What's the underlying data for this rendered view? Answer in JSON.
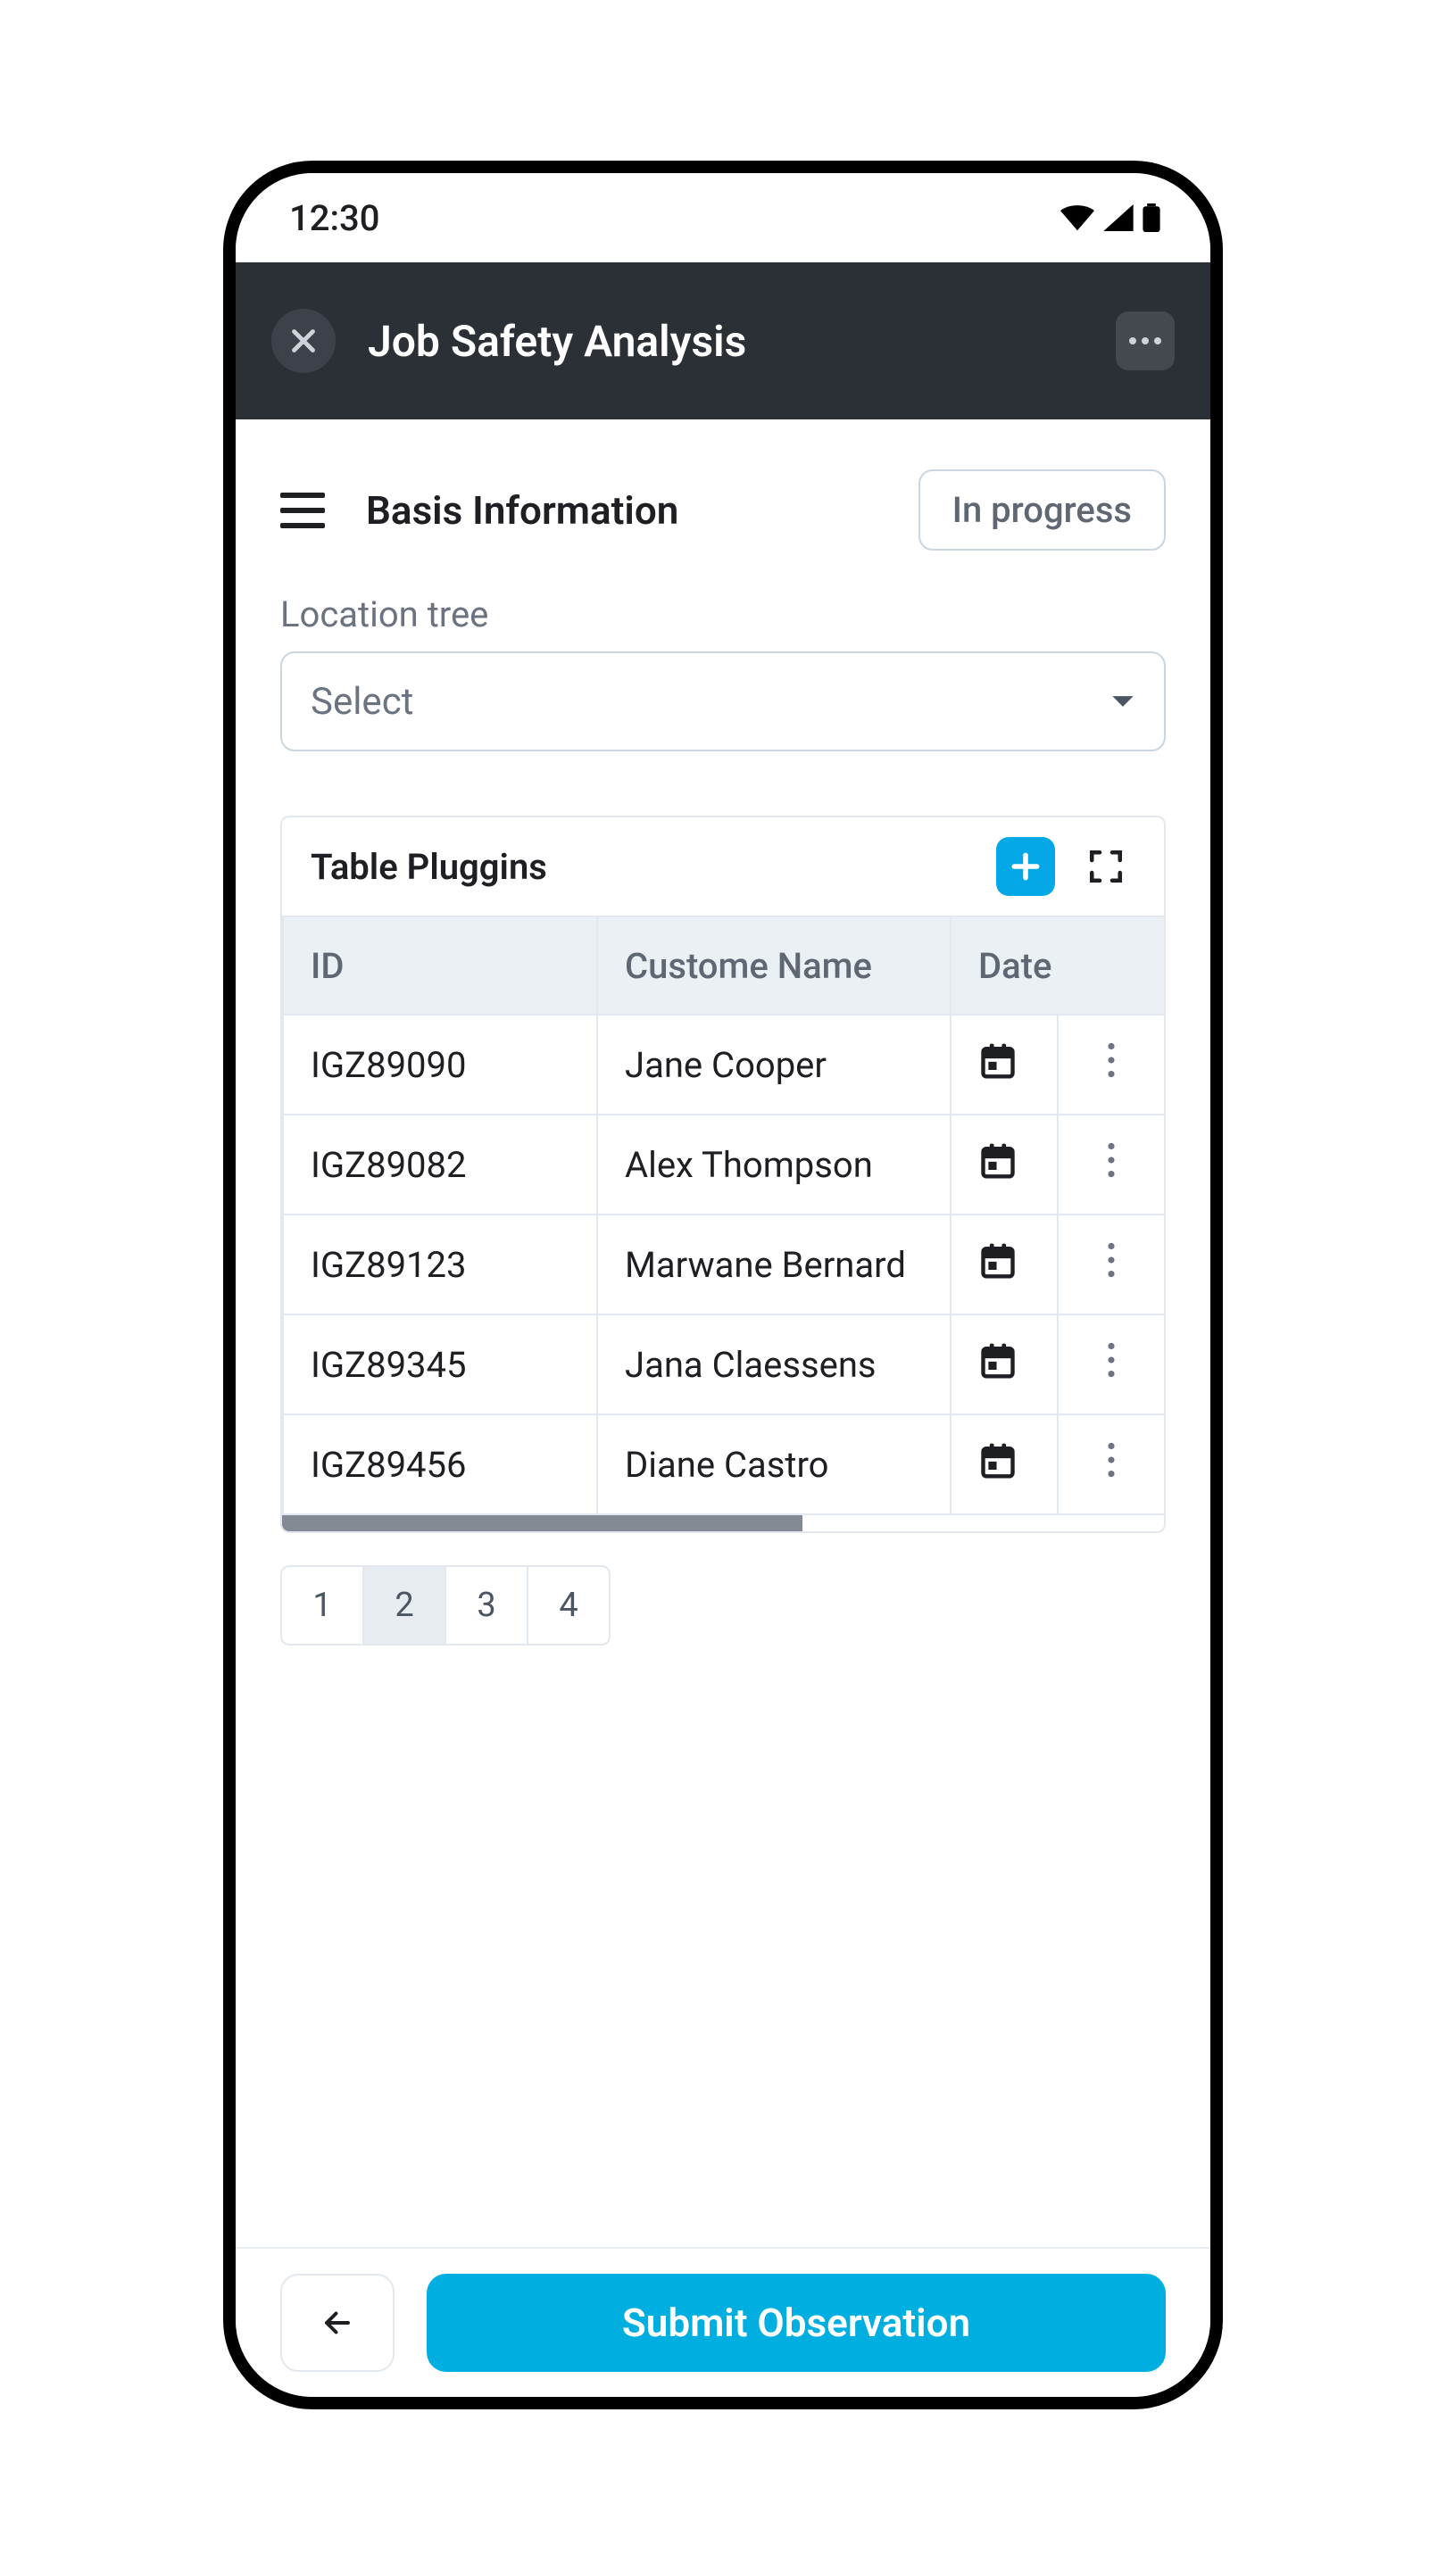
{
  "status_bar": {
    "time": "12:30"
  },
  "header": {
    "title": "Job Safety Analysis"
  },
  "section": {
    "title": "Basis Information",
    "status": "In progress"
  },
  "location": {
    "label": "Location tree",
    "placeholder": "Select"
  },
  "table_card": {
    "title": "Table Pluggins",
    "columns": {
      "id": "ID",
      "name": "Custome Name",
      "date": "Date"
    },
    "rows": [
      {
        "id": "IGZ89090",
        "name": "Jane Cooper"
      },
      {
        "id": "IGZ89082",
        "name": "Alex Thompson"
      },
      {
        "id": "IGZ89123",
        "name": "Marwane Bernard"
      },
      {
        "id": "IGZ89345",
        "name": "Jana Claessens"
      },
      {
        "id": "IGZ89456",
        "name": "Diane Castro"
      }
    ]
  },
  "pagination": {
    "pages": [
      "1",
      "2",
      "3",
      "4"
    ],
    "active_index": 1
  },
  "footer": {
    "submit": "Submit Observation"
  }
}
